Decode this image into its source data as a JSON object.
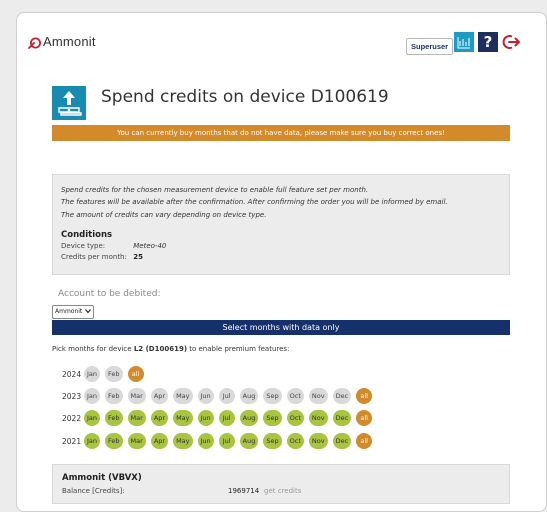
{
  "header": {
    "logo_text": "Ammonit",
    "user_role": "Superuser",
    "help_label": "?"
  },
  "title": {
    "text": "Spend credits on device D100619"
  },
  "banner": {
    "text": "You can currently buy months that do not have data, please make sure you buy correct ones!"
  },
  "info": {
    "line1": "Spend credits for the chosen measurement device to enable full feature set per month.",
    "line2": "The features will be available after the confirmation. After confirming the order you will be informed by email.",
    "line3": "The amount of credits can vary depending on device type.",
    "conditions_title": "Conditions",
    "device_type_label": "Device type:",
    "device_type_value": "Meteo-40",
    "credits_label": "Credits per month:",
    "credits_value": "25"
  },
  "account": {
    "label": "Account to be debited:",
    "selected": "Ammonit"
  },
  "select_button": "Select months with data only",
  "pick": {
    "prefix": "Pick months for device ",
    "device": "L2 (D100619)",
    "suffix": " to enable premium features:"
  },
  "months": {
    "rows": [
      {
        "year": "2024",
        "items": [
          {
            "label": "Jan",
            "state": "gray"
          },
          {
            "label": "Feb",
            "state": "gray"
          },
          {
            "label": "all",
            "state": "orange"
          }
        ]
      },
      {
        "year": "2023",
        "items": [
          {
            "label": "Jan",
            "state": "gray"
          },
          {
            "label": "Feb",
            "state": "gray"
          },
          {
            "label": "Mar",
            "state": "gray"
          },
          {
            "label": "Apr",
            "state": "gray"
          },
          {
            "label": "May",
            "state": "gray"
          },
          {
            "label": "Jun",
            "state": "gray"
          },
          {
            "label": "Jul",
            "state": "gray"
          },
          {
            "label": "Aug",
            "state": "gray"
          },
          {
            "label": "Sep",
            "state": "gray"
          },
          {
            "label": "Oct",
            "state": "gray"
          },
          {
            "label": "Nov",
            "state": "gray"
          },
          {
            "label": "Dec",
            "state": "gray"
          },
          {
            "label": "all",
            "state": "orange"
          }
        ]
      },
      {
        "year": "2022",
        "items": [
          {
            "label": "Jan",
            "state": "green"
          },
          {
            "label": "Feb",
            "state": "green"
          },
          {
            "label": "Mar",
            "state": "green"
          },
          {
            "label": "Apr",
            "state": "green"
          },
          {
            "label": "May",
            "state": "green"
          },
          {
            "label": "Jun",
            "state": "green"
          },
          {
            "label": "Jul",
            "state": "green"
          },
          {
            "label": "Aug",
            "state": "green"
          },
          {
            "label": "Sep",
            "state": "green"
          },
          {
            "label": "Oct",
            "state": "green"
          },
          {
            "label": "Nov",
            "state": "green"
          },
          {
            "label": "Dec",
            "state": "green"
          },
          {
            "label": "all",
            "state": "orange"
          }
        ]
      },
      {
        "year": "2021",
        "items": [
          {
            "label": "Jan",
            "state": "green"
          },
          {
            "label": "Feb",
            "state": "green"
          },
          {
            "label": "Mar",
            "state": "green"
          },
          {
            "label": "Apr",
            "state": "green"
          },
          {
            "label": "May",
            "state": "green"
          },
          {
            "label": "Jun",
            "state": "green"
          },
          {
            "label": "Jul",
            "state": "green"
          },
          {
            "label": "Aug",
            "state": "green"
          },
          {
            "label": "Sep",
            "state": "green"
          },
          {
            "label": "Oct",
            "state": "green"
          },
          {
            "label": "Nov",
            "state": "green"
          },
          {
            "label": "Dec",
            "state": "green"
          },
          {
            "label": "all",
            "state": "orange"
          }
        ]
      }
    ]
  },
  "balance": {
    "title": "Ammonit (VBVX)",
    "label": "Balance [Credits]:",
    "value": "1969714",
    "link": "get credits"
  },
  "colors": {
    "brand_navy": "#16306b",
    "accent_orange": "#d38a2b",
    "available_green": "#a9c441",
    "unavailable_gray": "#d9d9d9",
    "logo_red": "#c8202f"
  },
  "icons": [
    "ammonit-logo-icon",
    "chart-icon",
    "help-icon",
    "logout-icon",
    "credits-icon",
    "chevron-down-icon"
  ]
}
